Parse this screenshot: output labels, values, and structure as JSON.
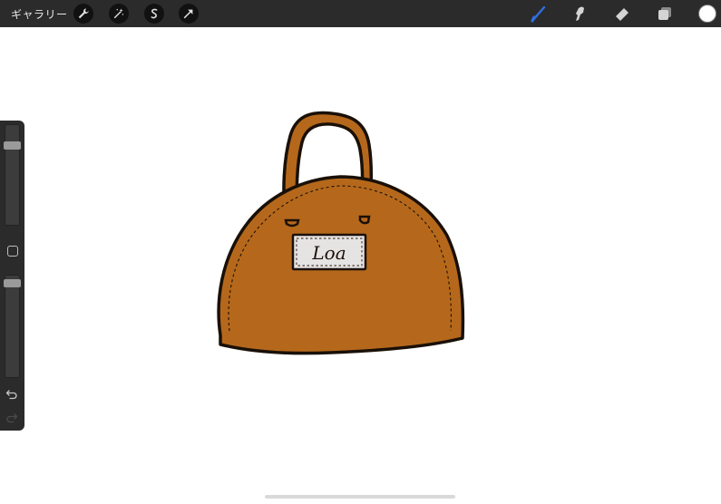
{
  "topbar": {
    "gallery_label": "ギャラリー",
    "left_tools": [
      "wrench-icon",
      "magic-wand-icon",
      "selection-s-icon",
      "transform-arrow-icon"
    ],
    "right_tools": [
      "brush-icon",
      "smudge-icon",
      "eraser-icon",
      "layers-icon"
    ],
    "active_tool": "brush",
    "current_color": "#ffffff"
  },
  "sidebar": {
    "brush_size_level": 0.82,
    "opacity_level": 0.95
  },
  "canvas": {
    "artwork": "handbag",
    "name_tag_text": "Loa",
    "colors": {
      "bag": "#b5681b",
      "outline": "#1a1008",
      "tag": "#e6e3e3",
      "accent": "#2f6fe0"
    }
  }
}
